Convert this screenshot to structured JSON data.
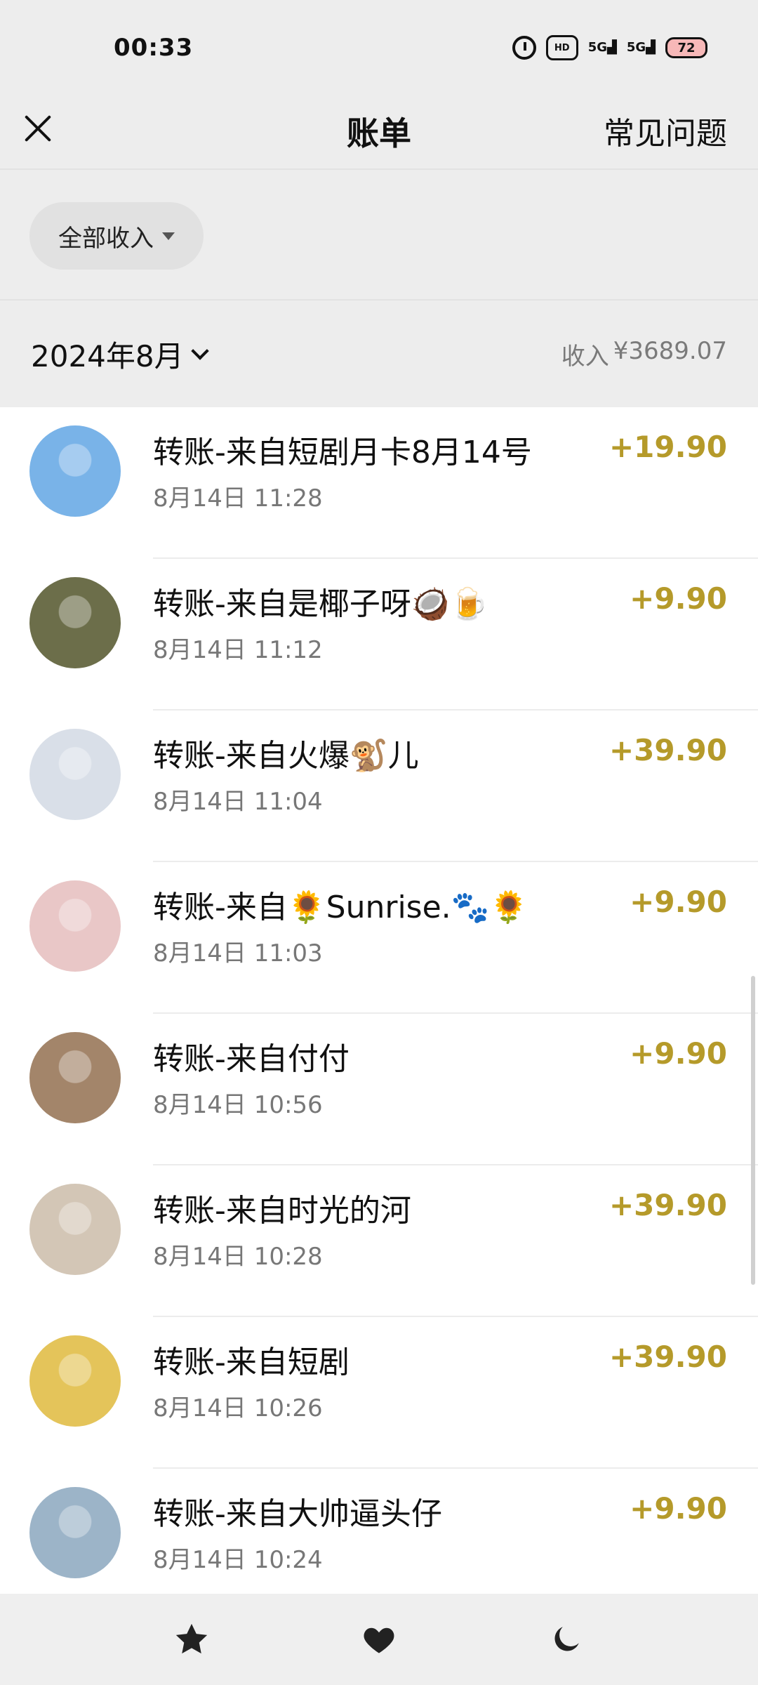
{
  "status_bar": {
    "time": "00:33",
    "signal_1": "5G",
    "signal_2": "5G",
    "battery": "72"
  },
  "nav": {
    "title": "账单",
    "faq": "常见问题"
  },
  "filter": {
    "label": "全部收入"
  },
  "month": {
    "label": "2024年8月",
    "summary_label": "收入",
    "summary_amount": "¥3689.07"
  },
  "transactions": [
    {
      "title": "转账-来自短剧月卡8月14号",
      "time": "8月14日 11:28",
      "amount": "+19.90",
      "avatar_color": "#79b3e8"
    },
    {
      "title": "转账-来自是椰子呀🥥🍺",
      "time": "8月14日 11:12",
      "amount": "+9.90",
      "avatar_color": "#6c6e4a"
    },
    {
      "title": "转账-来自火爆🐒儿",
      "time": "8月14日 11:04",
      "amount": "+39.90",
      "avatar_color": "#d9dfe8"
    },
    {
      "title": "转账-来自🌻Sunrise.🐾🌻",
      "time": "8月14日 11:03",
      "amount": "+9.90",
      "avatar_color": "#e9c7c7"
    },
    {
      "title": "转账-来自付付",
      "time": "8月14日 10:56",
      "amount": "+9.90",
      "avatar_color": "#a3856a"
    },
    {
      "title": "转账-来自时光的河",
      "time": "8月14日 10:28",
      "amount": "+39.90",
      "avatar_color": "#d3c6b6"
    },
    {
      "title": "转账-来自短剧",
      "time": "8月14日 10:26",
      "amount": "+39.90",
      "avatar_color": "#e4c45a"
    },
    {
      "title": "转账-来自大帅逼头仔",
      "time": "8月14日 10:24",
      "amount": "+9.90",
      "avatar_color": "#9cb4c8"
    }
  ],
  "tabs": [
    {
      "icon": "star-icon"
    },
    {
      "icon": "heart-icon"
    },
    {
      "icon": "moon-icon"
    }
  ],
  "colors": {
    "amount": "#b59a2a",
    "background": "#ededed"
  }
}
